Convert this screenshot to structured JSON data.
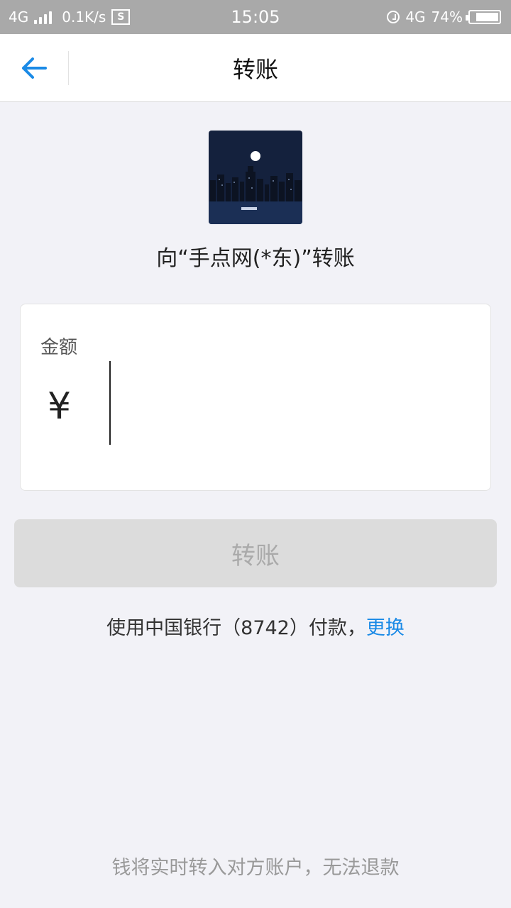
{
  "status_bar": {
    "network_left": "4G",
    "speed": "0.1K/s",
    "time": "15:05",
    "network_right": "4G",
    "battery": "74%"
  },
  "header": {
    "title": "转账"
  },
  "recipient": {
    "text": "向“手点网(*东)”转账"
  },
  "amount": {
    "label": "金额",
    "currency_symbol": "¥",
    "value": ""
  },
  "transfer_button": {
    "label": "转账"
  },
  "payment": {
    "text": "使用中国银行（8742）付款，",
    "change_link": "更换"
  },
  "footer": {
    "note": "钱将实时转入对方账户，无法退款"
  },
  "colors": {
    "accent": "#1a8ae6",
    "disabled_button": "#dcdcdc",
    "background": "#f2f2f7"
  }
}
